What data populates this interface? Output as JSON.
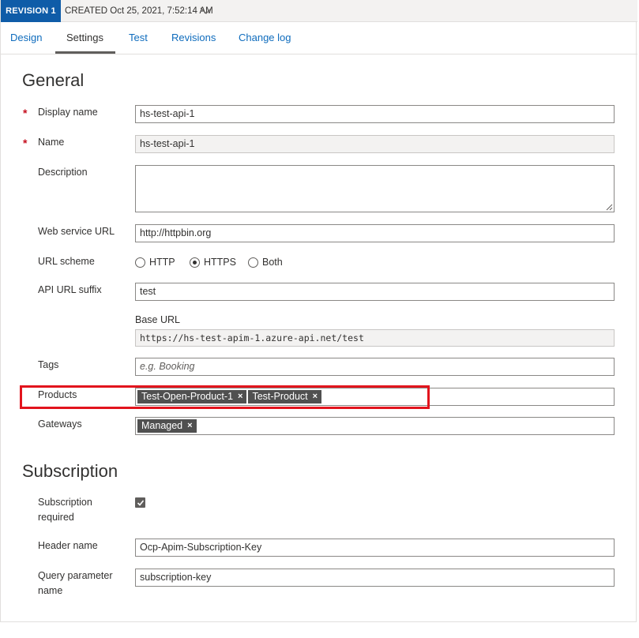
{
  "revision": {
    "badge": "REVISION 1",
    "created": "CREATED Oct 25, 2021, 7:52:14 AM",
    "chevron_icon": "chevron-down-icon"
  },
  "tabs": [
    {
      "label": "Design",
      "active": false
    },
    {
      "label": "Settings",
      "active": true
    },
    {
      "label": "Test",
      "active": false
    },
    {
      "label": "Revisions",
      "active": false
    },
    {
      "label": "Change log",
      "active": false
    }
  ],
  "general": {
    "title": "General",
    "display_name": {
      "label": "Display name",
      "value": "hs-test-api-1",
      "required": "*"
    },
    "name": {
      "label": "Name",
      "value": "hs-test-api-1",
      "required": "*"
    },
    "description": {
      "label": "Description",
      "value": ""
    },
    "web_service_url": {
      "label": "Web service URL",
      "value": "http://httpbin.org"
    },
    "url_scheme": {
      "label": "URL scheme",
      "options": [
        "HTTP",
        "HTTPS",
        "Both"
      ],
      "selected": "HTTPS"
    },
    "api_url_suffix": {
      "label": "API URL suffix",
      "value": "test"
    },
    "base_url": {
      "label": "Base URL",
      "value": "https://hs-test-apim-1.azure-api.net/test"
    },
    "tags": {
      "label": "Tags",
      "placeholder": "e.g. Booking"
    },
    "products": {
      "label": "Products",
      "chips": [
        "Test-Open-Product-1",
        "Test-Product"
      ],
      "remove_glyph": "×"
    },
    "gateways": {
      "label": "Gateways",
      "chips": [
        "Managed"
      ],
      "remove_glyph": "×"
    }
  },
  "subscription": {
    "title": "Subscription",
    "required": {
      "label_line1": "Subscription",
      "label_line2": "required",
      "checked": true
    },
    "header_name": {
      "label": "Header name",
      "value": "Ocp-Apim-Subscription-Key"
    },
    "query_param": {
      "label_line1": "Query parameter",
      "label_line2": "name",
      "value": "subscription-key"
    }
  },
  "colors": {
    "accent": "#0f5ca8",
    "link": "#0f6cbd",
    "highlight": "#e2141d",
    "required": "#c50f1f"
  }
}
